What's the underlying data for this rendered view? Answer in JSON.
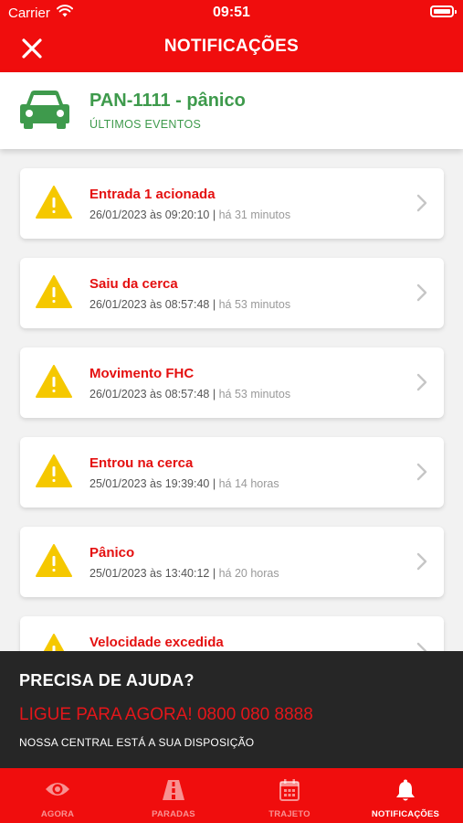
{
  "status_bar": {
    "carrier": "Carrier",
    "time": "09:51"
  },
  "header": {
    "title": "NOTIFICAÇÕES"
  },
  "vehicle": {
    "plate": "PAN-1111 - pânico",
    "subtitle": "ÚLTIMOS EVENTOS",
    "color": "#3e9a4c"
  },
  "events": [
    {
      "title": "Entrada 1 acionada",
      "datetime": "26/01/2023 às 09:20:10",
      "separator": " | ",
      "ago": "há 31 minutos"
    },
    {
      "title": "Saiu da cerca",
      "datetime": "26/01/2023 às 08:57:48",
      "separator": " | ",
      "ago": "há 53 minutos"
    },
    {
      "title": "Movimento FHC",
      "datetime": "26/01/2023 às 08:57:48",
      "separator": " | ",
      "ago": "há 53 minutos"
    },
    {
      "title": "Entrou na cerca",
      "datetime": "25/01/2023 às 19:39:40",
      "separator": " | ",
      "ago": "há 14 horas"
    },
    {
      "title": "Pânico",
      "datetime": "25/01/2023 às 13:40:12",
      "separator": " | ",
      "ago": "há 20 horas"
    },
    {
      "title": "Velocidade excedida",
      "datetime": "",
      "separator": "",
      "ago": ""
    }
  ],
  "help": {
    "title": "PRECISA DE AJUDA?",
    "call": "LIGUE PARA AGORA! 0800 080 8888",
    "note": "NOSSA CENTRAL ESTÁ A SUA DISPOSIÇÃO"
  },
  "tabs": [
    {
      "label": "AGORA",
      "icon": "eye-icon",
      "active": false
    },
    {
      "label": "PARADAS",
      "icon": "road-icon",
      "active": false
    },
    {
      "label": "TRAJETO",
      "icon": "calendar-icon",
      "active": false
    },
    {
      "label": "NOTIFICAÇÕES",
      "icon": "bell-icon",
      "active": true
    }
  ],
  "colors": {
    "brand": "#f00d0d",
    "event_title": "#e41010",
    "warning": "#f5c800",
    "help_bg": "#262626"
  }
}
